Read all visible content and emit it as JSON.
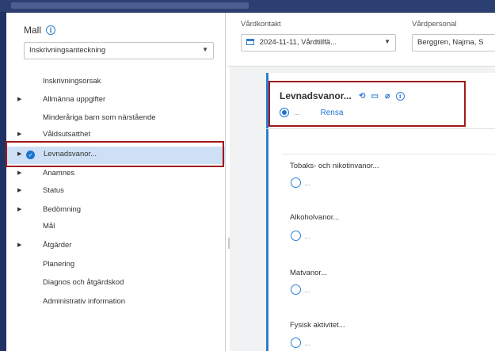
{
  "sidebar": {
    "title": "Mall",
    "template_select": "Inskrivningsanteckning",
    "items": [
      {
        "label": "Inskrivningsorsak",
        "has_arrow": false
      },
      {
        "label": "Allmänna uppgifter",
        "has_arrow": true
      },
      {
        "label": "Minderåriga barn som närstående",
        "has_arrow": false
      },
      {
        "label": "Våldsutsatthet",
        "has_arrow": true
      },
      {
        "label": "Levnadsvanor...",
        "has_arrow": true,
        "active": true
      },
      {
        "label": "Anamnes",
        "has_arrow": true
      },
      {
        "label": "Status",
        "has_arrow": true
      },
      {
        "label": "Bedömning",
        "has_arrow": true
      },
      {
        "label": "Mål",
        "has_arrow": false
      },
      {
        "label": "Åtgärder",
        "has_arrow": true
      },
      {
        "label": "Planering",
        "has_arrow": false
      },
      {
        "label": "Diagnos och åtgärdskod",
        "has_arrow": false
      },
      {
        "label": "Administrativ information",
        "has_arrow": false
      }
    ]
  },
  "header": {
    "vardkontakt_label": "Vårdkontakt",
    "vardkontakt_value": "2024-11-11, Vårdtillfä...",
    "vardpersonal_label": "Vårdpersonal",
    "vardpersonal_value": "Berggren, Najma, S"
  },
  "section": {
    "title": "Levnadsvanor...",
    "selected_value": "...",
    "clear_label": "Rensa",
    "subsections": [
      {
        "label": "Tobaks- och nikotinvanor...",
        "value": "..."
      },
      {
        "label": "Alkoholvanor...",
        "value": "..."
      },
      {
        "label": "Matvanor...",
        "value": "..."
      },
      {
        "label": "Fysisk aktivitet...",
        "value": "..."
      }
    ]
  },
  "colors": {
    "accent": "#1e73d0",
    "highlight_box": "#a11a1a",
    "active_row": "#cde0f5"
  }
}
